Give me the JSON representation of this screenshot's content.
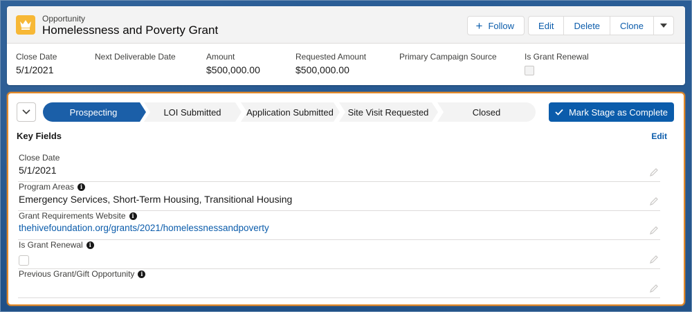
{
  "header": {
    "object_label": "Opportunity",
    "record_title": "Homelessness and Poverty Grant",
    "icon": "crown-icon",
    "buttons": {
      "follow": "Follow",
      "edit": "Edit",
      "delete": "Delete",
      "clone": "Clone"
    }
  },
  "highlights": [
    {
      "label": "Close Date",
      "value": "5/1/2021"
    },
    {
      "label": "Next Deliverable Date",
      "value": ""
    },
    {
      "label": "Amount",
      "value": "$500,000.00"
    },
    {
      "label": "Requested Amount",
      "value": "$500,000.00"
    },
    {
      "label": "Primary Campaign Source",
      "value": ""
    },
    {
      "label": "Is Grant Renewal",
      "value": ""
    }
  ],
  "path": {
    "stages": [
      "Prospecting",
      "LOI Submitted",
      "Application Submitted",
      "Site Visit Requested",
      "Closed"
    ],
    "active_index": 0,
    "mark_button": "Mark Stage as Complete"
  },
  "key_fields": {
    "title": "Key Fields",
    "edit_label": "Edit",
    "fields": [
      {
        "label": "Close Date",
        "value": "5/1/2021"
      },
      {
        "label": "Program Areas",
        "value": "Emergency Services, Short-Term Housing, Transitional Housing"
      },
      {
        "label": "Grant Requirements Website",
        "value": "thehivefoundation.org/grants/2021/homelessnessandpoverty"
      },
      {
        "label": "Is Grant Renewal",
        "value": ""
      },
      {
        "label": "Previous Grant/Gift Opportunity",
        "value": ""
      }
    ]
  },
  "colors": {
    "brand": "#0b5cab",
    "active_stage": "#1b5fa8",
    "inactive_stage": "#f3f3f3",
    "highlight_border": "#e58a28",
    "record_icon": "#f7b836"
  }
}
